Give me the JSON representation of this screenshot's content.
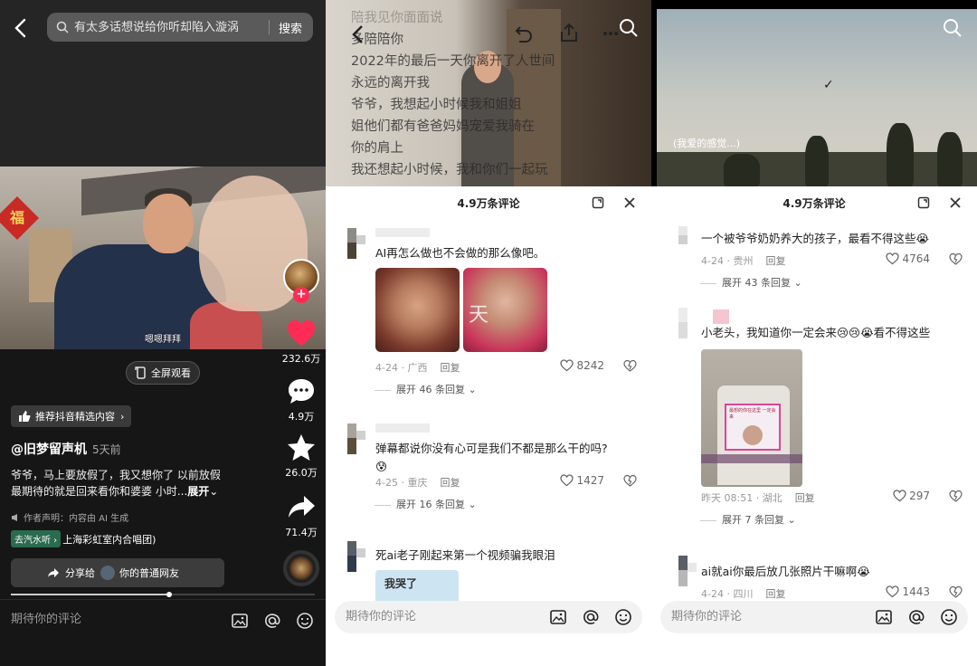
{
  "panel1": {
    "search": {
      "placeholder": "有太多话想说给你听却陷入漩涡",
      "button": "搜索"
    },
    "video_caption": "嗯嗯拜拜",
    "fu_char": "福",
    "rail": {
      "likes": "232.6万",
      "comments": "4.9万",
      "favorites": "26.0万",
      "shares": "71.4万"
    },
    "fullscreen_label": "全屏观看",
    "recommend_label": "推荐抖音精选内容",
    "author": "@旧梦留声机",
    "posted": "5天前",
    "desc_line1": "爷爷，马上要放假了，我又想你了 以前放假",
    "desc_line2": "最期待的就是回来看你和婆婆 小时...",
    "desc_more": "展开",
    "declaration": "作者声明：内容由 AI 生成",
    "music_tag": "去汽水听",
    "music_text": "上海彩虹室内合唱团)",
    "share_to": "分享给",
    "share_friend": "你的普通网友",
    "progress_percent": 52,
    "comment_placeholder": "期待你的评论",
    "colors": {
      "like": "#fe2c55",
      "bg": "#161616"
    }
  },
  "panel2": {
    "overlay_lines": [
      "陪我见你面面说",
      "多陪陪你",
      "2022年的最后一天你离开了人世间",
      "永远的离开我",
      "爷爷，我想起小时候我和姐姐",
      "姐他们都有爸爸妈妈宠爱我骑在",
      "你的肩上",
      "我还想起小时候，我和你们一起玩"
    ],
    "sheet_title": "4.9万条评论",
    "comments": [
      {
        "text": "AI再怎么做也不会做的那么像吧。",
        "date": "4-24 · 广西",
        "reply": "回复",
        "likes": "8242",
        "expand": "展开 46 条回复",
        "photo_text": "天"
      },
      {
        "text": "弹幕都说你没有心可是我们不都是那么干的吗?",
        "date": "4-25 · 重庆",
        "reply": "回复",
        "likes": "1427",
        "expand": "展开 16 条回复"
      },
      {
        "text": "死ai老子刚起来第一个视频骗我眼泪",
        "sticker_text": "我哭了"
      }
    ],
    "comment_placeholder": "期待你的评论"
  },
  "panel3": {
    "video_caption": "(我爱的感觉...)",
    "sheet_title": "4.9万条评论",
    "comments": [
      {
        "text": "一个被爷爷奶奶养大的孩子，最看不得这些😭",
        "date": "4-24 · 贵州",
        "reply": "回复",
        "likes": "4764",
        "expand": "展开 43 条回复"
      },
      {
        "text": "小老头，我知道你一定会来😢😢😭看不得这些",
        "date": "昨天 08:51 · 湖北",
        "reply": "回复",
        "likes": "297",
        "expand": "展开 7 条回复",
        "photo_text": "最想的你在这里 一定会来"
      },
      {
        "text": "ai就ai你最后放几张照片干嘛啊😭",
        "date": "4-24 · 四川",
        "reply": "回复",
        "likes": "1443"
      }
    ],
    "comment_placeholder": "期待你的评论"
  }
}
